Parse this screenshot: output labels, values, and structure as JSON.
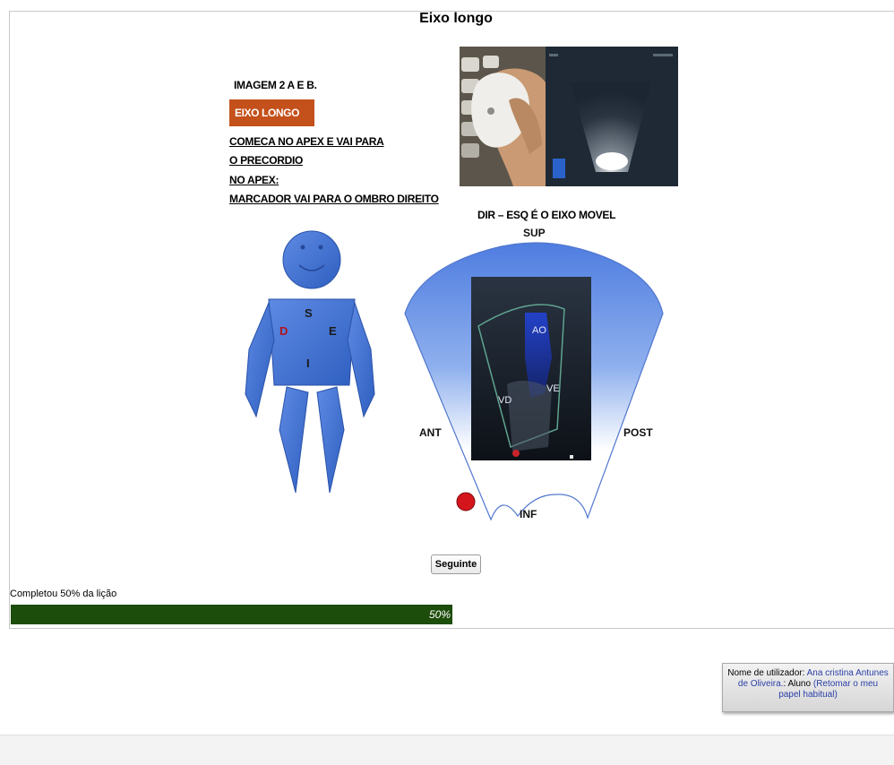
{
  "page": {
    "title": "Eixo longo"
  },
  "left_panel": {
    "heading": "IMAGEM 2 A  E  B.",
    "tag": "EIXO LONGO",
    "line1": "COMECA NO APEX E VAI PARA",
    "line2": "O PRECORDIO",
    "line3": "NO APEX:",
    "line4": "MARCADOR  VAI PARA O OMBRO DIREITO"
  },
  "figure": {
    "letter_s": "S",
    "letter_d": "D",
    "letter_e": "E",
    "letter_i": "I"
  },
  "diagram": {
    "caption": "DIR – ESQ   É O EIXO MOVEL",
    "sup": "SUP",
    "ant": "ANT",
    "post": "POST",
    "inf": "INF",
    "ao": "AO",
    "vd": "VD",
    "ve": "VE"
  },
  "navigation": {
    "next_label": "Seguinte"
  },
  "progress": {
    "label": "Completou 50% da lição",
    "value_text": "50%",
    "fraction": 0.5
  },
  "user_info": {
    "prefix": "Nome de utilizador:",
    "name": "Ana cristina Antunes de Oliveira.",
    "role_text": ": Aluno",
    "return_link": "(Retomar o meu papel habitual)"
  },
  "colors": {
    "figure_blue": "#3f6fd1",
    "tag_orange": "#c4501b",
    "progress_green": "#1d4d0a",
    "marker_red": "#d4151c"
  }
}
